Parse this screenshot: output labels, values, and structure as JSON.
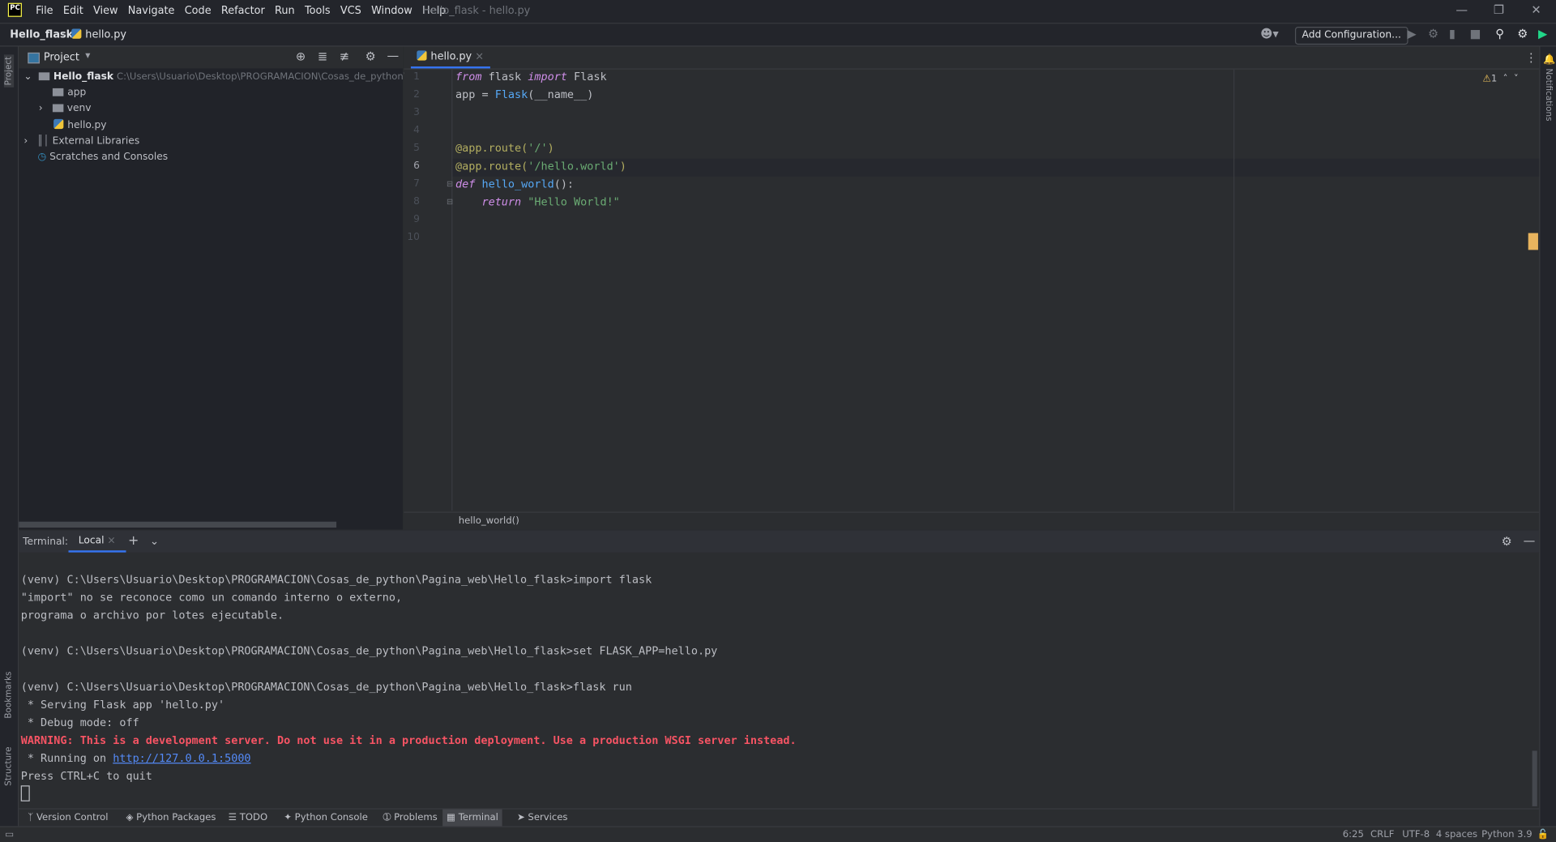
{
  "window": {
    "app_logo": "PC",
    "title": "Hello_flask - hello.py",
    "menu": [
      "File",
      "Edit",
      "View",
      "Navigate",
      "Code",
      "Refactor",
      "Run",
      "Tools",
      "VCS",
      "Window",
      "Help"
    ]
  },
  "navbar": {
    "project": "Hello_flask",
    "file": "hello.py",
    "add_configuration": "Add Configuration..."
  },
  "left_strip": {
    "project": "Project",
    "bookmarks": "Bookmarks",
    "structure": "Structure"
  },
  "right_strip": {
    "notifications": "Notifications"
  },
  "project_panel": {
    "title": "Project",
    "root": "Hello_flask",
    "root_path": "C:\\Users\\Usuario\\Desktop\\PROGRAMACION\\Cosas_de_python\\Pagin",
    "items": [
      "app",
      "venv",
      "hello.py"
    ],
    "external": "External Libraries",
    "scratches": "Scratches and Consoles"
  },
  "editor": {
    "tab": "hello.py",
    "warnings": "1",
    "breadcrumb": "hello_world()",
    "line_numbers": [
      "1",
      "2",
      "3",
      "4",
      "5",
      "6",
      "7",
      "8",
      "9",
      "10"
    ],
    "code": {
      "l1": {
        "a": "from",
        "b": " flask ",
        "c": "import",
        "d": " Flask"
      },
      "l2": {
        "a": "app = ",
        "b": "Flask",
        "c": "(__name__)"
      },
      "l5": {
        "a": "@app.route(",
        "b": "'/'",
        "c": ")"
      },
      "l6": {
        "a": "@app.route(",
        "b": "'/hello.world'",
        "c": ")"
      },
      "l7": {
        "a": "def",
        "b": " hello_world",
        "c": "():"
      },
      "l8": {
        "a": "    return",
        "b": " \"Hello World!\""
      }
    }
  },
  "terminal": {
    "label": "Terminal:",
    "tab": "Local",
    "lines": [
      "(venv) C:\\Users\\Usuario\\Desktop\\PROGRAMACION\\Cosas_de_python\\Pagina_web\\Hello_flask>import flask",
      "\"import\" no se reconoce como un comando interno o externo,",
      "programa o archivo por lotes ejecutable.",
      "",
      "(venv) C:\\Users\\Usuario\\Desktop\\PROGRAMACION\\Cosas_de_python\\Pagina_web\\Hello_flask>set FLASK_APP=hello.py",
      "",
      "(venv) C:\\Users\\Usuario\\Desktop\\PROGRAMACION\\Cosas_de_python\\Pagina_web\\Hello_flask>flask run",
      " * Serving Flask app 'hello.py'",
      " * Debug mode: off"
    ],
    "warning": "WARNING: This is a development server. Do not use it in a production deployment. Use a production WSGI server instead.",
    "running_prefix": " * Running on ",
    "running_url": "http://127.0.0.1:5000",
    "quit": "Press CTRL+C to quit"
  },
  "tool_tabs": [
    "Version Control",
    "Python Packages",
    "TODO",
    "Python Console",
    "Problems",
    "Terminal",
    "Services"
  ],
  "status": {
    "position": "6:25",
    "line_sep": "CRLF",
    "encoding": "UTF-8",
    "indent": "4 spaces",
    "interpreter": "Python 3.9"
  }
}
